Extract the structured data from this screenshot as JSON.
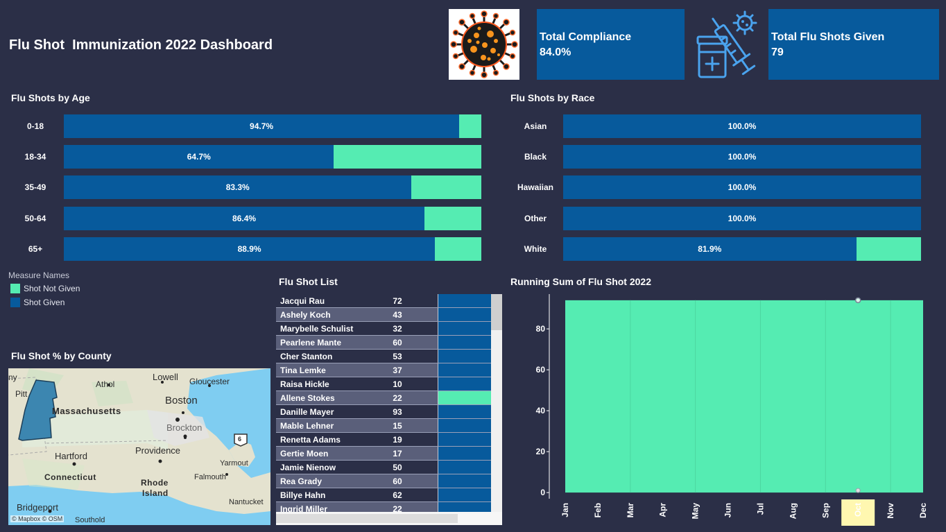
{
  "title": "Flu Shot  Immunization 2022 Dashboard",
  "icons": {
    "virus": "virus-icon",
    "syringe": "syringe-vaccine-icon"
  },
  "colors": {
    "background": "#2b2f47",
    "given": "#075a9c",
    "not_given": "#55ecb2",
    "kpi": "#075a9c",
    "highlight": "#fff7b0"
  },
  "kpis": {
    "compliance": {
      "label": "Total Compliance",
      "value": "84.0%"
    },
    "shots": {
      "label": "Total Flu Shots Given",
      "value": "79"
    }
  },
  "age": {
    "title": "Flu Shots by Age",
    "rows": [
      {
        "label": "0-18",
        "given": 94.7,
        "text": "94.7%"
      },
      {
        "label": "18-34",
        "given": 64.7,
        "text": "64.7%"
      },
      {
        "label": "35-49",
        "given": 83.3,
        "text": "83.3%"
      },
      {
        "label": "50-64",
        "given": 86.4,
        "text": "86.4%"
      },
      {
        "label": "65+",
        "given": 88.9,
        "text": "88.9%"
      }
    ]
  },
  "race": {
    "title": "Flu Shots by Race",
    "rows": [
      {
        "label": "Asian",
        "given": 100,
        "text": "100.0%"
      },
      {
        "label": "Black",
        "given": 100,
        "text": "100.0%"
      },
      {
        "label": "Hawaiian",
        "given": 100,
        "text": "100.0%"
      },
      {
        "label": "Other",
        "given": 100,
        "text": "100.0%"
      },
      {
        "label": "White",
        "given": 81.9,
        "text": "81.9%"
      }
    ]
  },
  "legend": {
    "title": "Measure Names",
    "items": [
      {
        "label": "Shot Not Given",
        "color": "#55ecb2"
      },
      {
        "label": "Shot Given",
        "color": "#075a9c"
      }
    ]
  },
  "county": {
    "title": "Flu Shot % by County",
    "labels": {
      "ny": "ny",
      "pitt": "Pitt",
      "athol": "Athol",
      "lowell": "Lowell",
      "gloucester": "Gloucester",
      "boston": "Boston",
      "massachusetts": "Massachusetts",
      "brockton": "Brockton",
      "hartford": "Hartford",
      "providence": "Providence",
      "yarmouth": "Yarmout",
      "connecticut": "Connecticut",
      "rhode": "Rhode",
      "island": "Island",
      "falmouth": "Falmouth",
      "nantucket": "Nantucket",
      "bridgeport": "Bridgeport",
      "southold": "Southold",
      "route": "6"
    },
    "attribution": "© Mapbox  © OSM"
  },
  "list": {
    "title": "Flu Shot List",
    "rows": [
      {
        "name": "Jacqui Rau",
        "age": "72",
        "given": true
      },
      {
        "name": "Ashely Koch",
        "age": "43",
        "given": true
      },
      {
        "name": "Marybelle Schulist",
        "age": "32",
        "given": true
      },
      {
        "name": "Pearlene Mante",
        "age": "60",
        "given": true
      },
      {
        "name": "Cher Stanton",
        "age": "53",
        "given": true
      },
      {
        "name": "Tina Lemke",
        "age": "37",
        "given": true
      },
      {
        "name": "Raisa Hickle",
        "age": "10",
        "given": true
      },
      {
        "name": "Allene Stokes",
        "age": "22",
        "given": false
      },
      {
        "name": "Danille Mayer",
        "age": "93",
        "given": true
      },
      {
        "name": "Mable Lehner",
        "age": "15",
        "given": true
      },
      {
        "name": "Renetta Adams",
        "age": "19",
        "given": true
      },
      {
        "name": "Gertie Moen",
        "age": "17",
        "given": true
      },
      {
        "name": "Jamie Nienow",
        "age": "50",
        "given": true
      },
      {
        "name": "Rea Grady",
        "age": "60",
        "given": true
      },
      {
        "name": "Billye Hahn",
        "age": "62",
        "given": true
      },
      {
        "name": "Ingrid Miller",
        "age": "22",
        "given": true
      }
    ]
  },
  "running": {
    "title": "Running Sum of Flu Shot 2022"
  },
  "chart_data": {
    "type": "area",
    "title": "Running Sum of Flu Shot 2022",
    "x": [
      "Jan",
      "Feb",
      "Mar",
      "Apr",
      "May",
      "Jun",
      "Jul",
      "Aug",
      "Sep",
      "Oct",
      "Nov",
      "Dec"
    ],
    "series": [
      {
        "values": [
          94,
          94,
          94,
          94,
          94,
          94,
          94,
          94,
          94,
          94,
          94,
          94
        ]
      }
    ],
    "yticks": [
      0,
      20,
      40,
      60,
      80
    ],
    "ylim": [
      -3,
      97
    ],
    "highlighted_x": "Oct",
    "grid": false,
    "color": "#55ecb2"
  }
}
